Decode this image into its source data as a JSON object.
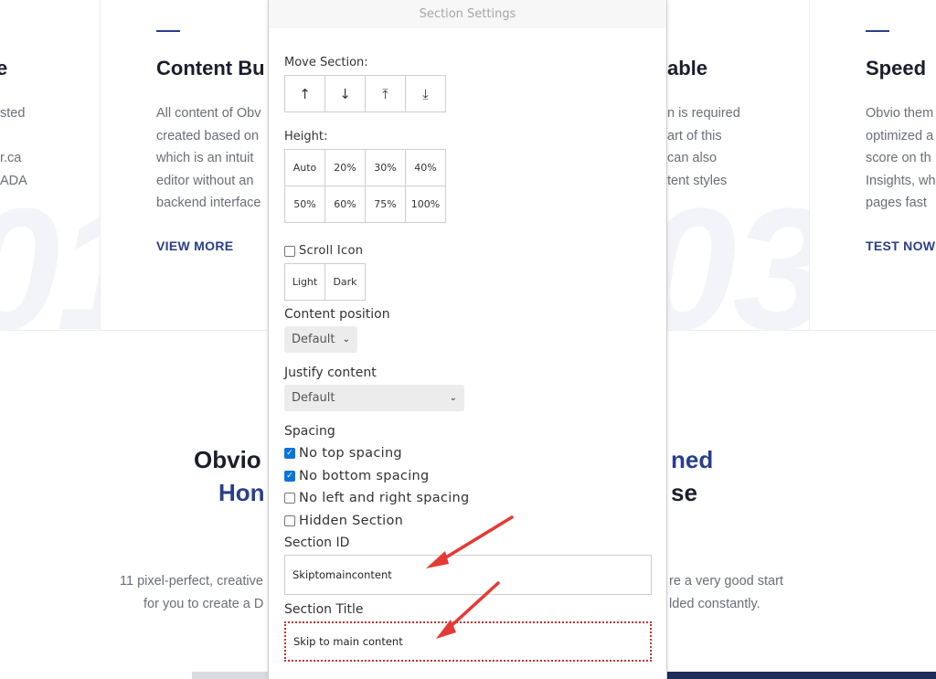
{
  "background": {
    "columns": [
      {
        "title": "e",
        "body": [
          "sted",
          "",
          "r.ca",
          "ADA"
        ],
        "link": "",
        "number": "01"
      },
      {
        "title": "Content Bu",
        "body": [
          "All content of Obv",
          "created based on",
          "which is an intuit",
          "editor without an",
          "backend interface"
        ],
        "link": "VIEW MORE",
        "number": ""
      },
      {
        "title": "able",
        "body": [
          "n is required",
          "art of this",
          "can also",
          "tent styles"
        ],
        "link": "",
        "number": "03"
      },
      {
        "title": "Speed",
        "body": [
          "Obvio them",
          "optimized a",
          "score on th",
          "Insights, wh",
          "pages fast"
        ],
        "link": "TEST NOW",
        "number": ""
      }
    ],
    "headline": {
      "left_line1": "Obvio",
      "right_line1": "ned",
      "left_line2": "Hon",
      "right_line2": "se"
    },
    "paragraph": {
      "left_line1": "11 pixel-perfect, creative",
      "right_line1": "re a very good start",
      "left_line2": "for you to create a D",
      "right_line2": "lded constantly."
    }
  },
  "modal": {
    "title": "Section Settings",
    "move_section": {
      "label": "Move Section:",
      "buttons": [
        {
          "glyph": "↑",
          "icon": "arrow-up-icon"
        },
        {
          "glyph": "↓",
          "icon": "arrow-down-icon"
        },
        {
          "glyph": "⤒",
          "icon": "arrow-to-top-icon"
        },
        {
          "glyph": "⤓",
          "icon": "arrow-to-bottom-icon"
        }
      ]
    },
    "height": {
      "label": "Height:",
      "options": [
        "Auto",
        "20%",
        "30%",
        "40%",
        "50%",
        "60%",
        "75%",
        "100%"
      ]
    },
    "scroll_icon": {
      "label": "Scroll Icon",
      "checked": false,
      "options": [
        "Light",
        "Dark"
      ]
    },
    "content_position": {
      "label": "Content position",
      "value": "Default"
    },
    "justify_content": {
      "label": "Justify content",
      "value": "Default"
    },
    "spacing": {
      "label": "Spacing",
      "options": [
        {
          "label": "No top spacing",
          "checked": true
        },
        {
          "label": "No bottom spacing",
          "checked": true
        },
        {
          "label": "No left and right spacing",
          "checked": false
        },
        {
          "label": "Hidden Section",
          "checked": false
        }
      ]
    },
    "section_id": {
      "label": "Section ID",
      "value": "Skiptomaincontent"
    },
    "section_title": {
      "label": "Section Title",
      "value": "Skip to main content"
    }
  },
  "colors": {
    "accent_blue": "#2a3e8c",
    "checkbox_blue": "#0a74d9",
    "annotation_red": "#e53935",
    "focus_dotted_red": "#c83232"
  }
}
